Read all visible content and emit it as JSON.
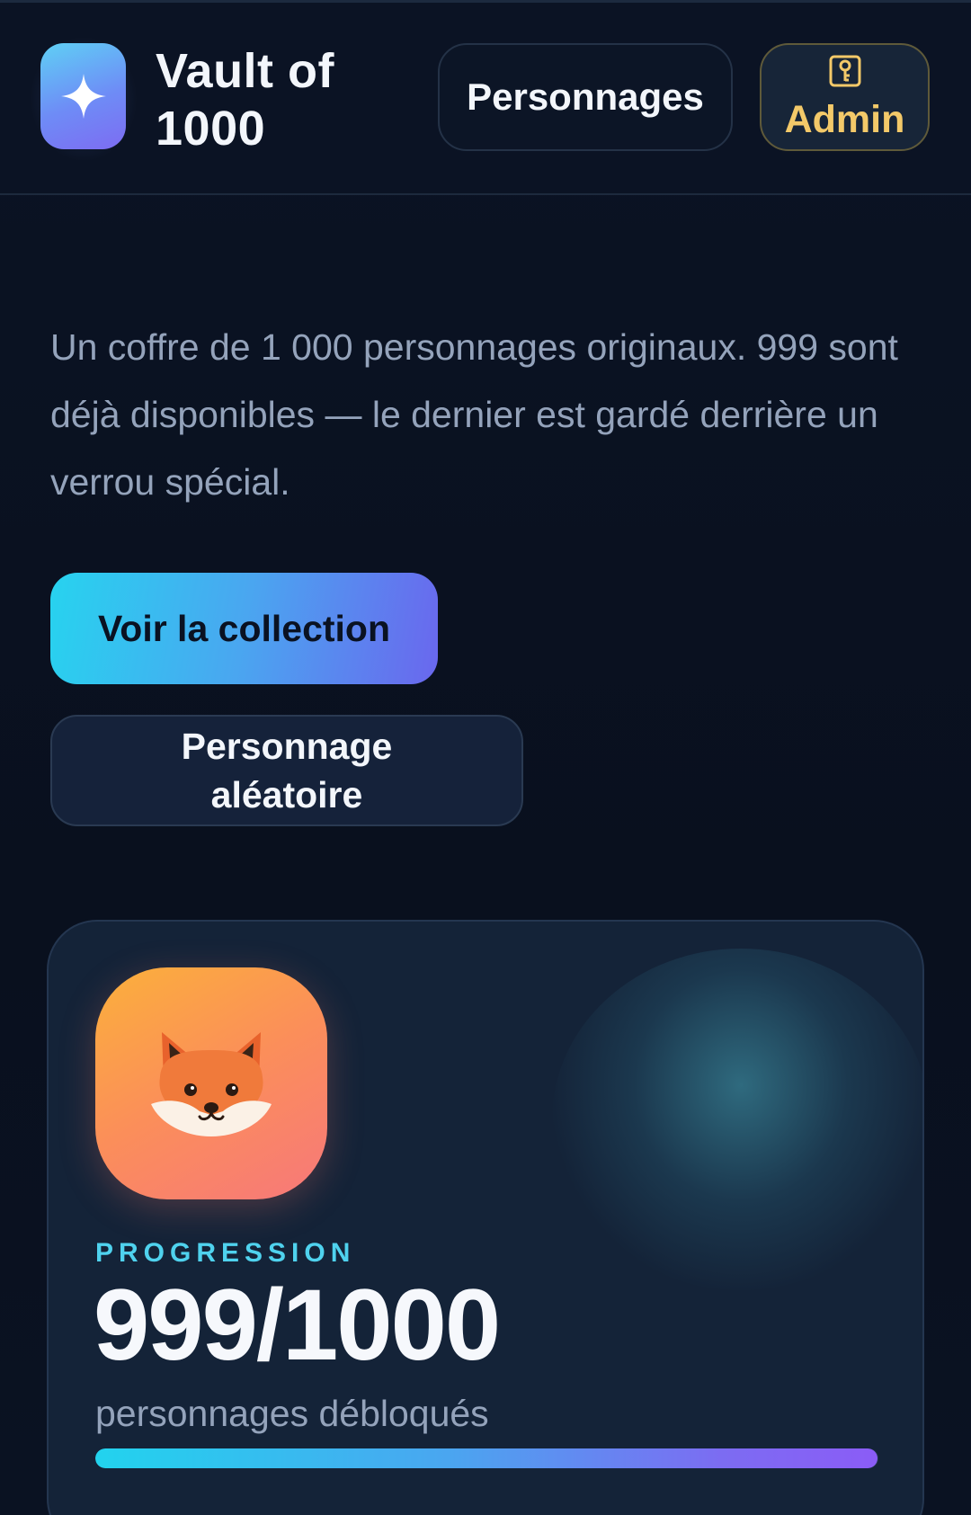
{
  "header": {
    "brand": "Vault of 1000",
    "logo_icon": "sparkle-icon",
    "nav": {
      "characters_label": "Personnages",
      "admin_label": "Admin",
      "admin_icon": "key-icon"
    }
  },
  "hero": {
    "intro": "Un coffre de 1 000 personnages originaux. 999 sont déjà disponibles — le dernier est gardé derrière un verrou spécial.",
    "primary_button": "Voir la collection",
    "secondary_button": "Personnage aléatoire"
  },
  "progress_card": {
    "avatar_emoji": "🦊",
    "label": "PROGRESSION",
    "value": "999/1000",
    "caption": "personnages débloqués",
    "fraction": 0.999
  },
  "colors": {
    "accent_cyan": "#22d3ee",
    "accent_violet": "#8b5cf6",
    "admin_gold": "#f3c969",
    "background": "#0a1120"
  }
}
